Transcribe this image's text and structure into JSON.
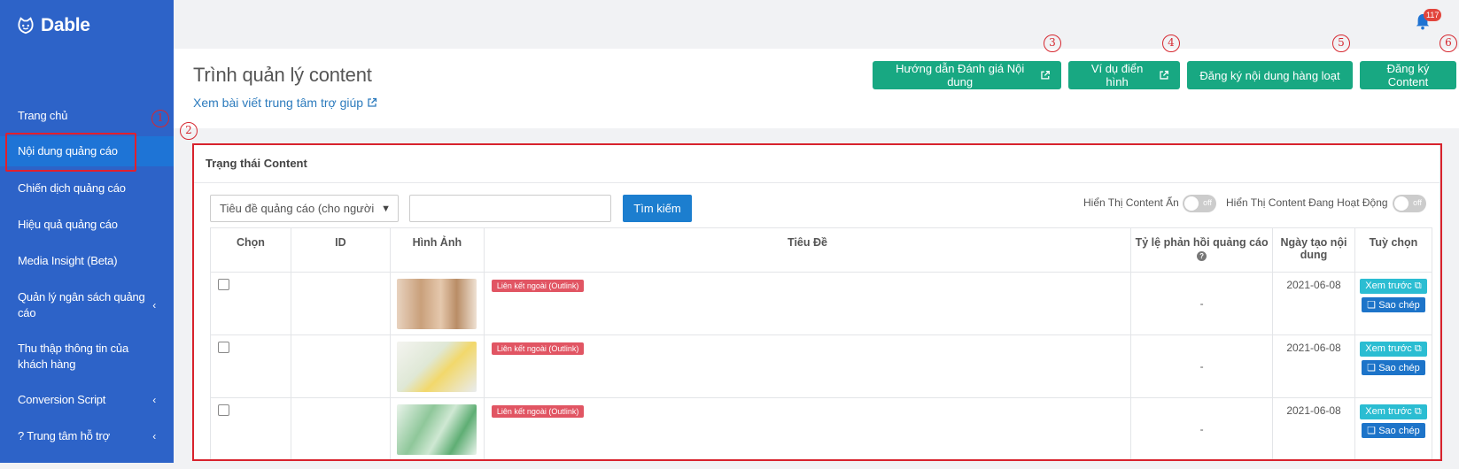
{
  "app": {
    "logo_text": "Dable"
  },
  "sidebar": {
    "items": [
      {
        "label": "Trang chủ",
        "chevron": false
      },
      {
        "label": "Nội dung quảng cáo",
        "chevron": false,
        "active": true
      },
      {
        "label": "Chiến dịch quảng cáo",
        "chevron": false
      },
      {
        "label": "Hiệu quả quảng cáo",
        "chevron": false
      },
      {
        "label": "Media Insight (Beta)",
        "chevron": false
      },
      {
        "label": "Quản lý ngân sách quảng cáo",
        "chevron": true
      },
      {
        "label": "Thu thập thông tin của khách hàng",
        "chevron": false
      },
      {
        "label": "Conversion Script",
        "chevron": true
      },
      {
        "label": "?  Trung tâm hỗ trợ",
        "chevron": true
      }
    ]
  },
  "annotations": {
    "n1": "1",
    "n2": "2",
    "n3": "3",
    "n4": "4",
    "n5": "5",
    "n6": "6"
  },
  "topbar": {
    "notification_count": "117"
  },
  "header": {
    "title": "Trình quản lý content",
    "help_link": "Xem bài viết trung tâm trợ giúp",
    "buttons": {
      "guide": "Hướng dẫn Đánh giá Nội dung",
      "examples": "Ví dụ điển hình",
      "bulk_register": "Đăng ký nội dung hàng loạt",
      "register": "Đăng ký Content"
    }
  },
  "panel": {
    "title": "Trạng thái Content",
    "search_field": {
      "selected": "Tiêu đề quảng cáo (cho người"
    },
    "search_button": "Tìm kiếm",
    "toggles": [
      {
        "label": "Hiển Thị Content Ẩn",
        "state": "off"
      },
      {
        "label": "Hiển Thị Content Đang Hoạt Động",
        "state": "off"
      }
    ]
  },
  "table": {
    "headers": {
      "select": "Chọn",
      "id": "ID",
      "image": "Hình Ảnh",
      "title": "Tiêu Đề",
      "ctr": "Tỷ lệ phản hồi quảng cáo",
      "created": "Ngày tạo nội dung",
      "options": "Tuỳ chọn"
    },
    "rows": [
      {
        "badge": "Liên kết ngoài (Outlink)",
        "ctr": "-",
        "date": "2021-06-08",
        "preview": "Xem trước",
        "copy": "Sao chép"
      },
      {
        "badge": "Liên kết ngoài (Outlink)",
        "ctr": "-",
        "date": "2021-06-08",
        "preview": "Xem trước",
        "copy": "Sao chép"
      },
      {
        "badge": "Liên kết ngoài (Outlink)",
        "ctr": "-",
        "date": "2021-06-08",
        "preview": "Xem trước",
        "copy": "Sao chép"
      }
    ]
  },
  "colors": {
    "sidebar": "#2d63c8",
    "accent_green": "#18a882",
    "annotation_red": "#d62830",
    "badge_red": "#e15563"
  }
}
